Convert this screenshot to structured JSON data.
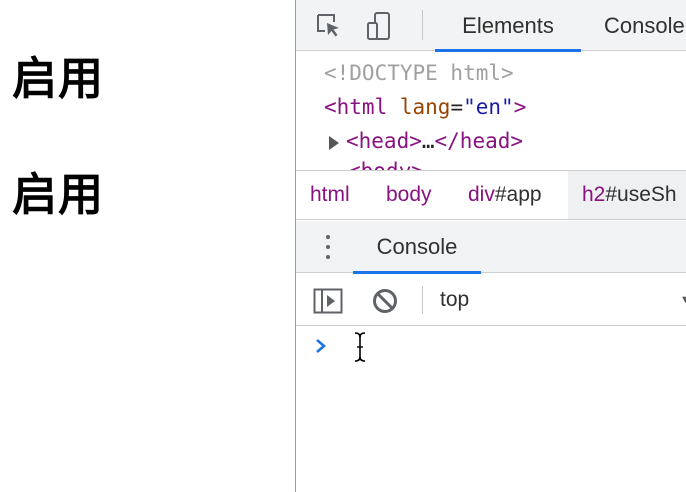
{
  "page": {
    "headings": [
      "启用",
      "启用"
    ]
  },
  "devtools": {
    "toolbar": {
      "icons": [
        "inspect-element-icon",
        "device-toggle-icon"
      ],
      "tabs": [
        {
          "label": "Elements",
          "active": true
        },
        {
          "label": "Console",
          "active": false
        }
      ]
    },
    "dom_tree": {
      "doctype": "<!DOCTYPE html>",
      "html_tag_open": "<html",
      "html_attr_name": "lang",
      "html_attr_eq": "=",
      "html_attr_value": "\"en\"",
      "html_tag_close": ">",
      "head_open": "<head>",
      "head_ellipsis": "…",
      "head_close": "</head>",
      "body_partial": "<body>"
    },
    "breadcrumbs": [
      {
        "tag": "html",
        "rest": ""
      },
      {
        "tag": "body",
        "rest": ""
      },
      {
        "tag": "div",
        "rest": "#app"
      },
      {
        "tag": "h2",
        "rest": "#useSh"
      }
    ],
    "drawer": {
      "tab_label": "Console",
      "context": "top",
      "prompt_symbol": "›"
    },
    "colors": {
      "accent": "#1a73e8",
      "tag": "#881280",
      "attr": "#994500",
      "value": "#1a1aa6"
    }
  }
}
